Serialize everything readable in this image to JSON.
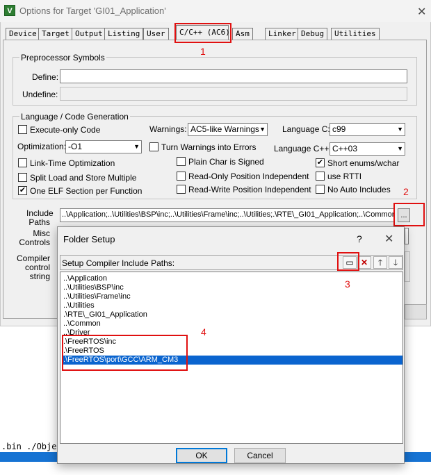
{
  "window": {
    "title": "Options for Target 'GI01_Application'",
    "icon": "keil-uvision-icon",
    "close_glyph": "✕"
  },
  "tabs": [
    {
      "label": "Device"
    },
    {
      "label": "Target"
    },
    {
      "label": "Output"
    },
    {
      "label": "Listing"
    },
    {
      "label": "User"
    },
    {
      "label": "C/C++ (AC6)",
      "active": true
    },
    {
      "label": "Asm"
    },
    {
      "label": "Linker"
    },
    {
      "label": "Debug"
    },
    {
      "label": "Utilities"
    }
  ],
  "preprocessor": {
    "group_label": "Preprocessor Symbols",
    "define_label": "Define:",
    "define_value": "",
    "undefine_label": "Undefine:",
    "undefine_value": ""
  },
  "language": {
    "group_label": "Language / Code Generation",
    "execute_only": {
      "label": "Execute-only Code",
      "checked": false
    },
    "warnings_label": "Warnings:",
    "warnings_value": "AC5-like Warnings",
    "language_c_label": "Language C:",
    "language_c_value": "c99",
    "optimization_label": "Optimization:",
    "optimization_value": "-O1",
    "turn_warnings": {
      "label": "Turn Warnings into Errors",
      "checked": false
    },
    "language_cpp_label": "Language C++:",
    "language_cpp_value": "C++03",
    "link_time": {
      "label": "Link-Time Optimization",
      "checked": false
    },
    "plain_char": {
      "label": "Plain Char is Signed",
      "checked": false
    },
    "short_enums": {
      "label": "Short enums/wchar",
      "checked": true
    },
    "split_load": {
      "label": "Split Load and Store Multiple",
      "checked": false
    },
    "ro_pi": {
      "label": "Read-Only Position Independent",
      "checked": false
    },
    "use_rtti": {
      "label": "use RTTI",
      "checked": false
    },
    "one_elf": {
      "label": "One ELF Section per Function",
      "checked": true
    },
    "rw_pi": {
      "label": "Read-Write Position Independent",
      "checked": false
    },
    "no_auto_includes": {
      "label": "No Auto Includes",
      "checked": false
    }
  },
  "include": {
    "label_line1": "Include",
    "label_line2": "Paths",
    "value": "..\\Application;..\\Utilities\\BSP\\inc;..\\Utilities\\Frame\\inc;..\\Utilities;.\\RTE\\_GI01_Application;..\\Common",
    "browse_label": "..."
  },
  "misc": {
    "label_line1": "Misc",
    "label_line2": "Controls"
  },
  "compiler": {
    "label_line1": "Compiler",
    "label_line2": "control",
    "label_line3": "string"
  },
  "console": {
    "text": ".bin ./Obje"
  },
  "annotations": {
    "n1": "1",
    "n2": "2",
    "n3": "3",
    "n4": "4",
    "color": "#e01010"
  },
  "dialog": {
    "title": "Folder Setup",
    "help": "?",
    "close": "✕",
    "toolbar_label": "Setup Compiler Include Paths:",
    "toolbar_icons": [
      "new-folder-icon",
      "delete-icon",
      "move-up-icon",
      "move-down-icon"
    ],
    "paths": [
      "..\\Application",
      "..\\Utilities\\BSP\\inc",
      "..\\Utilities\\Frame\\inc",
      "..\\Utilities",
      ".\\RTE\\_GI01_Application",
      "..\\Common",
      "..\\Driver",
      ".\\FreeRTOS\\inc",
      ".\\FreeRTOS",
      ".\\FreeRTOS\\port\\GCC\\ARM_CM3"
    ],
    "selected_index": 9,
    "ok_label": "OK",
    "cancel_label": "Cancel"
  },
  "colors": {
    "selection": "#0a64cf",
    "status_strip": "#1673d3",
    "annotation": "#e01010"
  }
}
